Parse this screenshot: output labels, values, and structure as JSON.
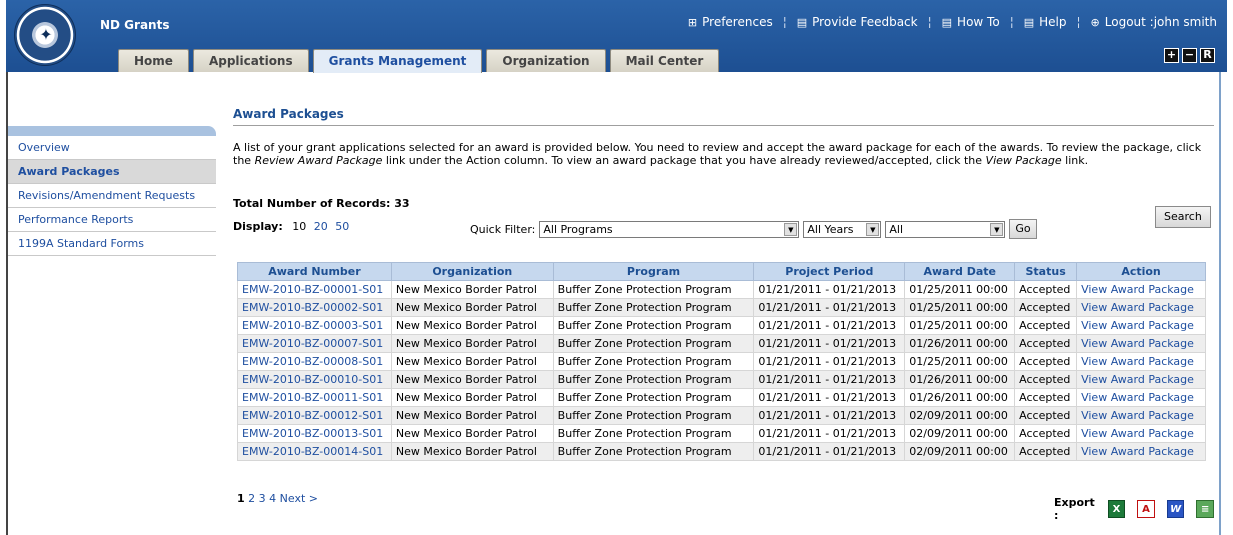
{
  "header": {
    "app_title": "ND Grants",
    "top_links": [
      {
        "label": "Preferences",
        "icon": "preferences-icon"
      },
      {
        "label": "Provide Feedback",
        "icon": "feedback-icon"
      },
      {
        "label": "How To",
        "icon": "howto-icon"
      },
      {
        "label": "Help",
        "icon": "help-icon"
      },
      {
        "label": "Logout :john smith",
        "icon": "logout-icon"
      }
    ],
    "tabs": [
      "Home",
      "Applications",
      "Grants Management",
      "Organization",
      "Mail Center"
    ],
    "active_tab": "Grants Management",
    "zoom": [
      "+",
      "−",
      "R"
    ]
  },
  "sidebar": {
    "items": [
      "Overview",
      "Award Packages",
      "Revisions/Amendment Requests",
      "Performance Reports",
      "1199A Standard Forms"
    ],
    "active": "Award Packages"
  },
  "main": {
    "title": "Award Packages",
    "desc_1": "A list of your grant applications selected for an award is provided below. You need to review and accept the award package for each of the awards. To review the package, click the ",
    "desc_em1": "Review Award Package",
    "desc_2": " link under the Action column. To view an award package that you have already reviewed/accepted, click the ",
    "desc_em2": "View Package",
    "desc_3": " link.",
    "records_label": "Total Number of Records: 33",
    "display_label": "Display:",
    "page_sizes": [
      "10",
      "20",
      "50"
    ],
    "quick_filter_label": "Quick Filter:",
    "filter_program": "All Programs",
    "filter_year": "All Years",
    "filter_status": "All",
    "go_label": "Go",
    "search_label": "Search"
  },
  "table": {
    "columns": [
      "Award Number",
      "Organization",
      "Program",
      "Project Period",
      "Award Date",
      "Status",
      "Action"
    ],
    "rows": [
      [
        "EMW-2010-BZ-00001-S01",
        "New Mexico Border Patrol",
        "Buffer Zone Protection Program",
        "01/21/2011 - 01/21/2013",
        "01/25/2011 00:00",
        "Accepted",
        "View Award Package"
      ],
      [
        "EMW-2010-BZ-00002-S01",
        "New Mexico Border Patrol",
        "Buffer Zone Protection Program",
        "01/21/2011 - 01/21/2013",
        "01/25/2011 00:00",
        "Accepted",
        "View Award Package"
      ],
      [
        "EMW-2010-BZ-00003-S01",
        "New Mexico Border Patrol",
        "Buffer Zone Protection Program",
        "01/21/2011 - 01/21/2013",
        "01/25/2011 00:00",
        "Accepted",
        "View Award Package"
      ],
      [
        "EMW-2010-BZ-00007-S01",
        "New Mexico Border Patrol",
        "Buffer Zone Protection Program",
        "01/21/2011 - 01/21/2013",
        "01/26/2011 00:00",
        "Accepted",
        "View Award Package"
      ],
      [
        "EMW-2010-BZ-00008-S01",
        "New Mexico Border Patrol",
        "Buffer Zone Protection Program",
        "01/21/2011 - 01/21/2013",
        "01/25/2011 00:00",
        "Accepted",
        "View Award Package"
      ],
      [
        "EMW-2010-BZ-00010-S01",
        "New Mexico Border Patrol",
        "Buffer Zone Protection Program",
        "01/21/2011 - 01/21/2013",
        "01/26/2011 00:00",
        "Accepted",
        "View Award Package"
      ],
      [
        "EMW-2010-BZ-00011-S01",
        "New Mexico Border Patrol",
        "Buffer Zone Protection Program",
        "01/21/2011 - 01/21/2013",
        "01/26/2011 00:00",
        "Accepted",
        "View Award Package"
      ],
      [
        "EMW-2010-BZ-00012-S01",
        "New Mexico Border Patrol",
        "Buffer Zone Protection Program",
        "01/21/2011 - 01/21/2013",
        "02/09/2011 00:00",
        "Accepted",
        "View Award Package"
      ],
      [
        "EMW-2010-BZ-00013-S01",
        "New Mexico Border Patrol",
        "Buffer Zone Protection Program",
        "01/21/2011 - 01/21/2013",
        "02/09/2011 00:00",
        "Accepted",
        "View Award Package"
      ],
      [
        "EMW-2010-BZ-00014-S01",
        "New Mexico Border Patrol",
        "Buffer Zone Protection Program",
        "01/21/2011 - 01/21/2013",
        "02/09/2011 00:00",
        "Accepted",
        "View Award Package"
      ]
    ]
  },
  "pager": {
    "pages": [
      "1",
      "2",
      "3",
      "4"
    ],
    "next_label": "Next >",
    "current": "1"
  },
  "export": {
    "label": "Export :",
    "formats": [
      {
        "name": "excel-icon",
        "glyph": "X"
      },
      {
        "name": "pdf-icon",
        "glyph": "A"
      },
      {
        "name": "word-icon",
        "glyph": "W"
      },
      {
        "name": "csv-icon",
        "glyph": "≡"
      }
    ]
  },
  "colors": {
    "header": "#1d4f92",
    "link": "#1f4fa0",
    "table_header": "#c6d8ee"
  }
}
